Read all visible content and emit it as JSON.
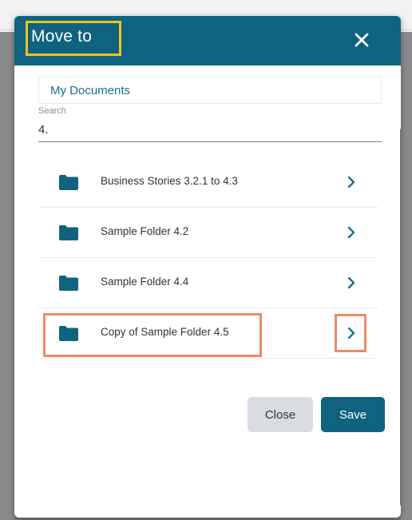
{
  "dialog": {
    "title": "Move to",
    "close_icon": "close-icon",
    "path_label": "My Documents",
    "search": {
      "label": "Search",
      "value": "4."
    },
    "folders": [
      {
        "name": "Business Stories 3.2.1 to 4.3",
        "icon": "folder-icon"
      },
      {
        "name": "Sample Folder 4.2",
        "icon": "folder-icon"
      },
      {
        "name": "Sample Folder 4.4",
        "icon": "folder-icon"
      },
      {
        "name": "Copy of Sample Folder 4.5",
        "icon": "folder-icon"
      }
    ],
    "buttons": {
      "close_label": "Close",
      "save_label": "Save"
    }
  },
  "colors": {
    "header": "#0f6380",
    "accent_text": "#1f6e8c",
    "title_highlight": "#f3c31c",
    "row_highlight": "#ee8a64",
    "close_button_bg": "#d9dde2",
    "save_button_bg": "#0f6380"
  }
}
